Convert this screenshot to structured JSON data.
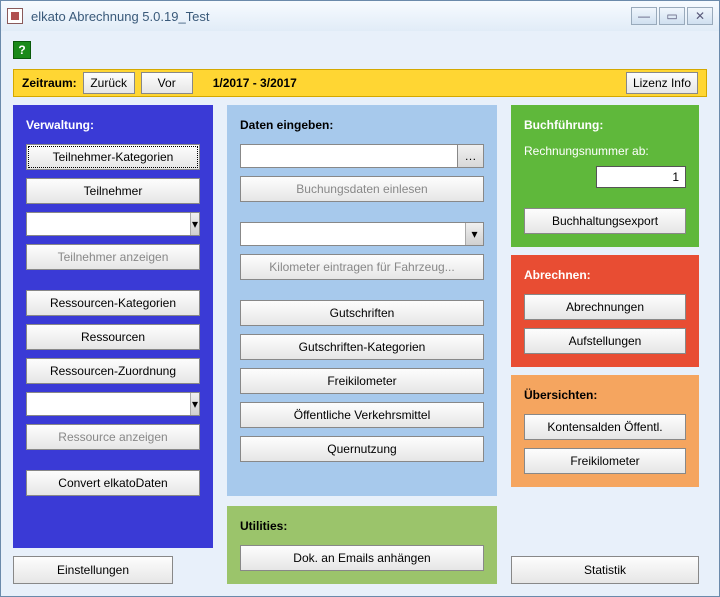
{
  "window": {
    "title": "elkato Abrechnung 5.0.19_Test"
  },
  "timebar": {
    "label": "Zeitraum:",
    "back": "Zurück",
    "forward": "Vor",
    "range": "1/2017 - 3/2017",
    "licence": "Lizenz Info"
  },
  "verwaltung": {
    "title": "Verwaltung:",
    "teiln_kat": "Teilnehmer-Kategorien",
    "teilnehmer": "Teilnehmer",
    "teiln_anz": "Teilnehmer anzeigen",
    "res_kat": "Ressourcen-Kategorien",
    "ressourcen": "Ressourcen",
    "res_zuordnung": "Ressourcen-Zuordnung",
    "res_anz": "Ressource anzeigen",
    "convert": "Convert elkatoDaten"
  },
  "daten": {
    "title": "Daten eingeben:",
    "einlesen": "Buchungsdaten einlesen",
    "km": "Kilometer eintragen für Fahrzeug...",
    "gutschriften": "Gutschriften",
    "gut_kat": "Gutschriften-Kategorien",
    "freikm": "Freikilometer",
    "oeffentl": "Öffentliche Verkehrsmittel",
    "quer": "Quernutzung"
  },
  "utilities": {
    "title": "Utilities:",
    "dok": "Dok. an Emails anhängen"
  },
  "buchf": {
    "title": "Buchführung:",
    "rn_label": "Rechnungsnummer ab:",
    "rn_value": "1",
    "export": "Buchhaltungsexport"
  },
  "abrech": {
    "title": "Abrechnen:",
    "abrechnungen": "Abrechnungen",
    "aufstellungen": "Aufstellungen"
  },
  "ueber": {
    "title": "Übersichten:",
    "konten": "Kontensalden Öffentl.",
    "freikm": "Freikilometer"
  },
  "bottom": {
    "einstellungen": "Einstellungen",
    "statistik": "Statistik"
  }
}
